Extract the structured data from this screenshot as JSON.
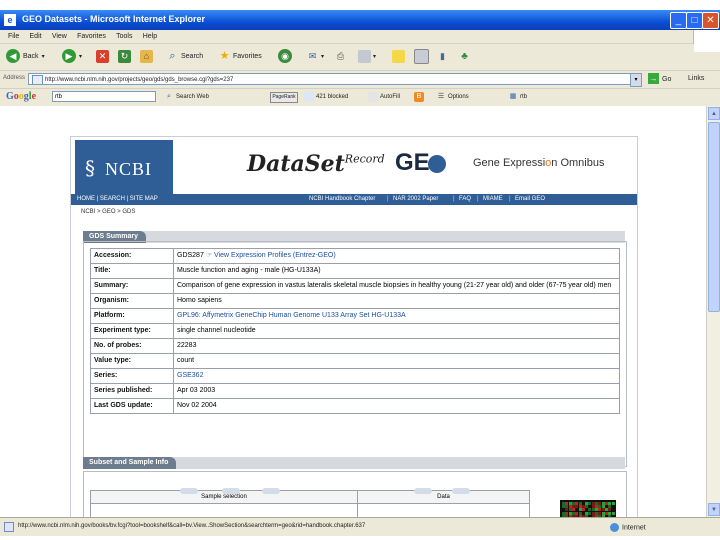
{
  "window": {
    "title": "GEO Datasets - Microsoft Internet Explorer",
    "app_icon": "ie-page-icon"
  },
  "menu": [
    "File",
    "Edit",
    "View",
    "Favorites",
    "Tools",
    "Help"
  ],
  "toolbar": {
    "back": "Back",
    "search": "Search",
    "favorites": "Favorites"
  },
  "address": {
    "label": "Address",
    "url": "http://www.ncbi.nlm.nih.gov/projects/geo/gds/gds_browse.cgi?gds=237",
    "go": "Go",
    "links": "Links"
  },
  "google": {
    "logo": "Google",
    "query": "rtb",
    "search_web": "Search Web",
    "pagerank": "PageRank",
    "blocked": "421 blocked",
    "autofill": "AutoFill",
    "options": "Options",
    "rtb": "rtb"
  },
  "banner": {
    "ncbi": "NCBI",
    "dataset": "DataSet",
    "record": "Record",
    "geo": "GE",
    "geo_title_pre": "Gene Expressi",
    "geo_title_o": "o",
    "geo_title_post": "n Omnibus"
  },
  "nav": {
    "left": "HOME  |  SEARCH  |  SITE MAP",
    "right": [
      "NCBI Handbook Chapter",
      "NAR 2002 Paper",
      "FAQ",
      "MIAME",
      "Email GEO"
    ]
  },
  "breadcrumb": "NCBI > GEO > GDS",
  "gds_summary": {
    "heading": "GDS Summary",
    "rows": [
      {
        "label": "Accession:",
        "value": "GDS287",
        "link": "View Expression Profiles (Entrez-GEO)"
      },
      {
        "label": "Title:",
        "value": "Muscle function and aging - male (HG-U133A)"
      },
      {
        "label": "Summary:",
        "value": "Comparison of gene expression in vastus lateralis skeletal muscle biopsies in healthy young (21-27 year old) and older (67-75 year old) men"
      },
      {
        "label": "Organism:",
        "value": "Homo sapiens"
      },
      {
        "label": "Platform:",
        "link": "GPL96: Affymetrix GeneChip Human Genome U133 Array Set HG-U133A"
      },
      {
        "label": "Experiment type:",
        "value": "single channel nucleotide"
      },
      {
        "label": "No. of probes:",
        "value": "22283"
      },
      {
        "label": "Value type:",
        "value": "count"
      },
      {
        "label": "Series:",
        "link": "GSE362"
      },
      {
        "label": "Series published:",
        "value": "Apr 03 2003"
      },
      {
        "label": "Last GDS update:",
        "value": "Nov 02 2004"
      }
    ]
  },
  "subset": {
    "heading": "Subset and Sample Info",
    "col_sample": "Sample selection",
    "col_data": "Data"
  },
  "status": {
    "text": "http://www.ncbi.nlm.nih.gov/books/bv.fcgi?tool=bookshelf&call=bv.View..ShowSection&searchterm=geo&rid=handbook.chapter.637",
    "zone": "Internet"
  }
}
